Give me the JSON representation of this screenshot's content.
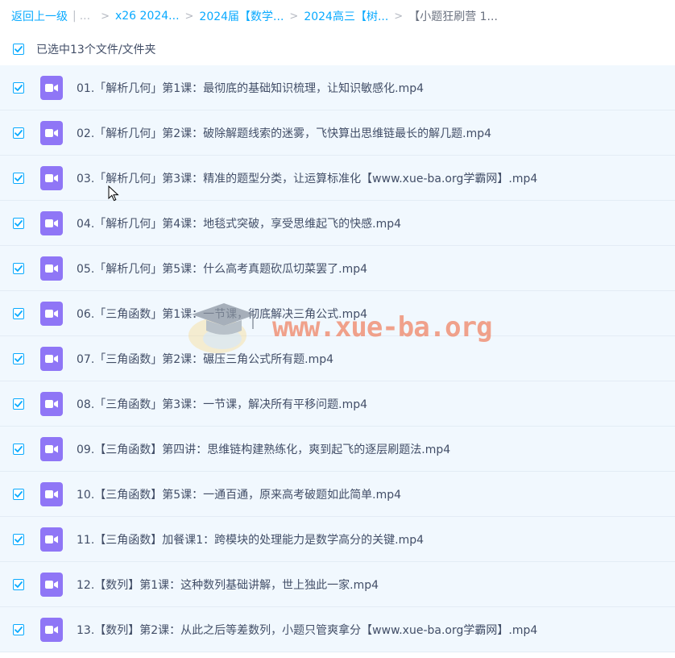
{
  "breadcrumb": {
    "back": "返回上一级",
    "ellipsis": "...",
    "items": [
      "x26 2024...",
      "2024届【数学...",
      "2024高三【树...",
      "【小题狂刷营 1..."
    ]
  },
  "selection": {
    "text": "已选中13个文件/文件夹"
  },
  "files": [
    "01.「解析几何」第1课：最彻底的基础知识梳理，让知识敏感化.mp4",
    "02.「解析几何」第2课：破除解题线索的迷雾，飞快算出思维链最长的解几题.mp4",
    "03.「解析几何」第3课：精准的题型分类，让运算标准化【www.xue-ba.org学霸网】.mp4",
    "04.「解析几何」第4课：地毯式突破，享受思维起飞的快感.mp4",
    "05.「解析几何」第5课：什么高考真题砍瓜切菜罢了.mp4",
    "06.「三角函数」第1课：一节课，彻底解决三角公式.mp4",
    "07.「三角函数」第2课：碾压三角公式所有题.mp4",
    "08.「三角函数」第3课：一节课，解决所有平移问题.mp4",
    "09.【三角函数】第四讲：思维链构建熟练化，爽到起飞的逐层刷题法.mp4",
    "10.【三角函数】第5课：一通百通，原来高考破题如此简单.mp4",
    "11.【三角函数】加餐课1：跨模块的处理能力是数学高分的关键.mp4",
    "12.【数列】第1课：这种数列基础讲解，世上独此一家.mp4",
    "13.【数列】第2课：从此之后等差数列，小题只管爽拿分【www.xue-ba.org学霸网】.mp4"
  ],
  "watermark": {
    "text": "www.xue-ba.org"
  },
  "colors": {
    "accent": "#09aaff",
    "row_bg": "#f1f8fe",
    "video_icon": "#8f76f6",
    "text": "#424e67",
    "watermark": "#f08060"
  },
  "icons": {
    "checkbox": "checkmark-icon",
    "file": "video-file-icon",
    "separator": "chevron-right-icon"
  }
}
